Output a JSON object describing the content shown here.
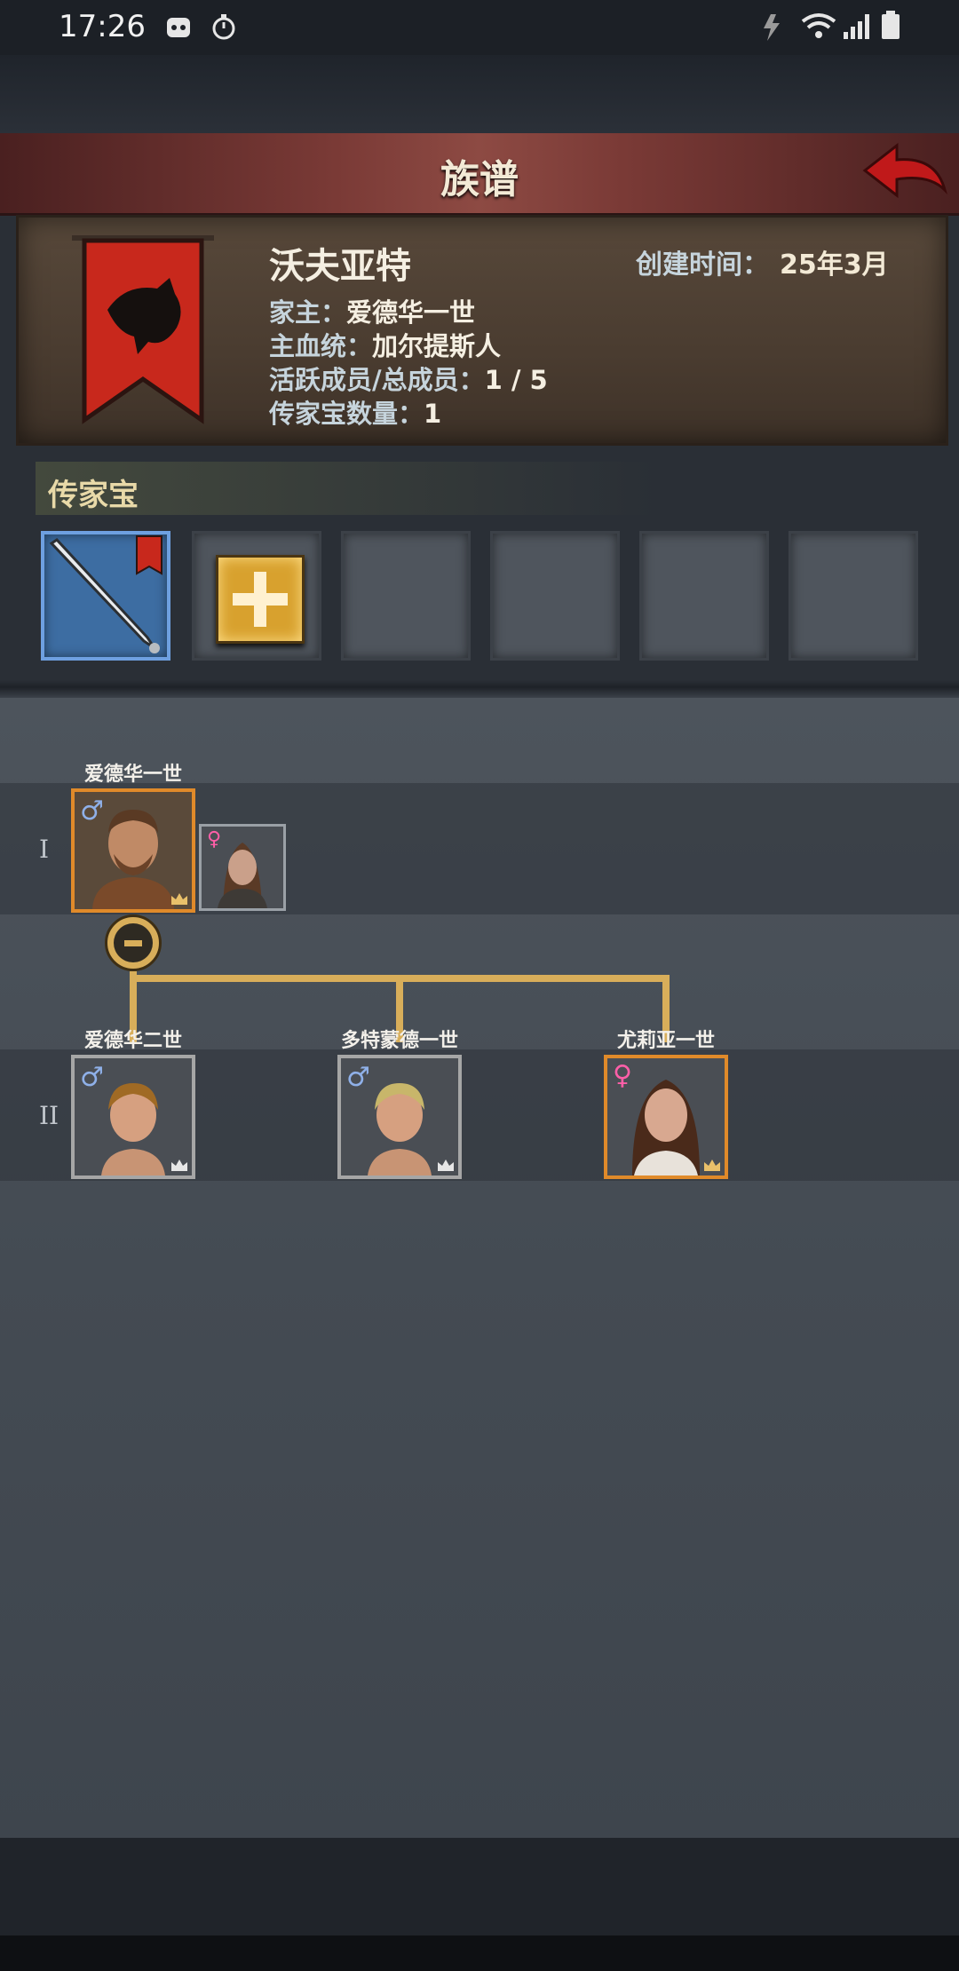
{
  "status_bar": {
    "time": "17:26"
  },
  "header": {
    "title": "族谱"
  },
  "clan": {
    "name": "沃夫亚特",
    "created_label": "创建时间：",
    "created_value": "25年3月",
    "head_label": "家主：",
    "head_value": "爱德华一世",
    "bloodline_label": "主血统：",
    "bloodline_value": "加尔提斯人",
    "members_label": "活跃成员/总成员：",
    "members_value": "1 / 5",
    "heirloom_count_label": "传家宝数量：",
    "heirloom_count_value": "1",
    "banner_color": "#c8281c"
  },
  "heirlooms": {
    "title": "传家宝",
    "slots": [
      {
        "state": "sword",
        "icon": "sword-icon"
      },
      {
        "state": "add",
        "icon": "plus-icon"
      },
      {
        "state": "empty"
      },
      {
        "state": "empty"
      },
      {
        "state": "empty"
      },
      {
        "state": "empty"
      }
    ]
  },
  "tree": {
    "generations": [
      {
        "label": "I",
        "members": [
          {
            "name": "爱德华一世",
            "gender": "♂",
            "highlight": true,
            "spouse_gender": "♀"
          }
        ]
      },
      {
        "label": "II",
        "members": [
          {
            "name": "爱德华二世",
            "gender": "♂",
            "highlight": false
          },
          {
            "name": "多特蒙德一世",
            "gender": "♂",
            "highlight": false
          },
          {
            "name": "尤莉亚一世",
            "gender": "♀",
            "highlight": true
          }
        ]
      }
    ]
  },
  "colors": {
    "accent_gold": "#d8ae5a",
    "highlight_orange": "#e08a2a",
    "title_red": "#8d4a43"
  }
}
